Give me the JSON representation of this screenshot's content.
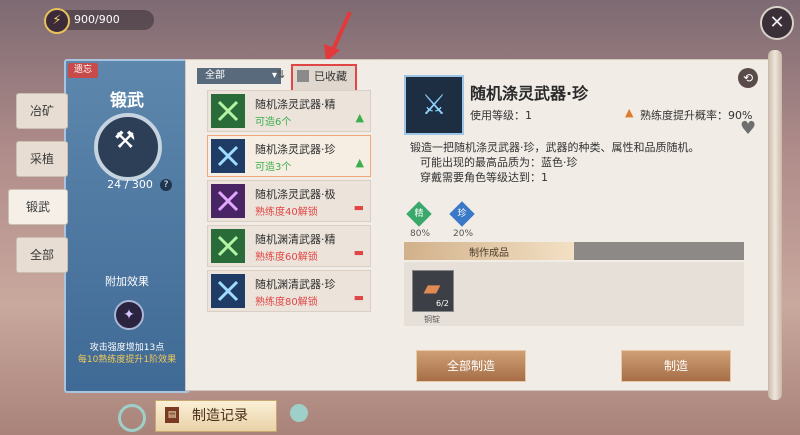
{
  "energy": {
    "value": "900/900",
    "icon": "lightning-icon"
  },
  "left_panel": {
    "tag": "遗忘",
    "title": "锻武",
    "count": "24 / 300",
    "help": "?",
    "bonus_label": "附加效果",
    "bonus_line1": "攻击强度增加13点",
    "bonus_line2": "每10熟练度提升1阶效果"
  },
  "side_tabs": [
    "冶矿",
    "采植",
    "锻武",
    "全部"
  ],
  "filter": {
    "dropdown": "全部",
    "fav_label": "已收藏"
  },
  "recipes": [
    {
      "name": "随机涤灵武器·精",
      "status": "可造6个",
      "status_color": "#3cae4b",
      "mark": "▲",
      "mark_color": "#3cae4b",
      "icon_color": "#2a6b3a"
    },
    {
      "name": "随机涤灵武器·珍",
      "status": "可造3个",
      "status_color": "#3cae4b",
      "mark": "▲",
      "mark_color": "#3cae4b",
      "icon_color": "#1f3c66"
    },
    {
      "name": "随机涤灵武器·极",
      "status": "熟练度40解锁",
      "status_color": "#e04646",
      "mark": "▬",
      "mark_color": "#e04646",
      "icon_color": "#4a2566"
    },
    {
      "name": "随机渊清武器·精",
      "status": "熟练度60解锁",
      "status_color": "#e04646",
      "mark": "▬",
      "mark_color": "#e04646",
      "icon_color": "#2a6b3a"
    },
    {
      "name": "随机渊清武器·珍",
      "status": "熟练度80解锁",
      "status_color": "#e04646",
      "mark": "▬",
      "mark_color": "#e04646",
      "icon_color": "#1f3c66"
    }
  ],
  "detail": {
    "name": "随机涤灵武器·珍",
    "level": "使用等级：1",
    "rate": "熟练度提升概率：90%",
    "desc1": "锻造一把随机涤灵武器·珍，武器的种类、属性和品质随机。",
    "desc2": "可能出现的最高品质为：蓝色·珍",
    "desc3": "穿戴需要角色等级达到：1",
    "qualities": [
      {
        "label": "精",
        "pct": "80%",
        "color": "#3aa86a"
      },
      {
        "label": "珍",
        "pct": "20%",
        "color": "#3a78c8"
      }
    ],
    "product_title": "制作成品",
    "product": {
      "count": "6/2",
      "name": "铜锭"
    }
  },
  "buttons": {
    "craft_all": "全部制造",
    "craft": "制造",
    "record": "制造记录"
  },
  "colors": {
    "accent_red": "#e04646",
    "craftable_green": "#3cae4b"
  }
}
